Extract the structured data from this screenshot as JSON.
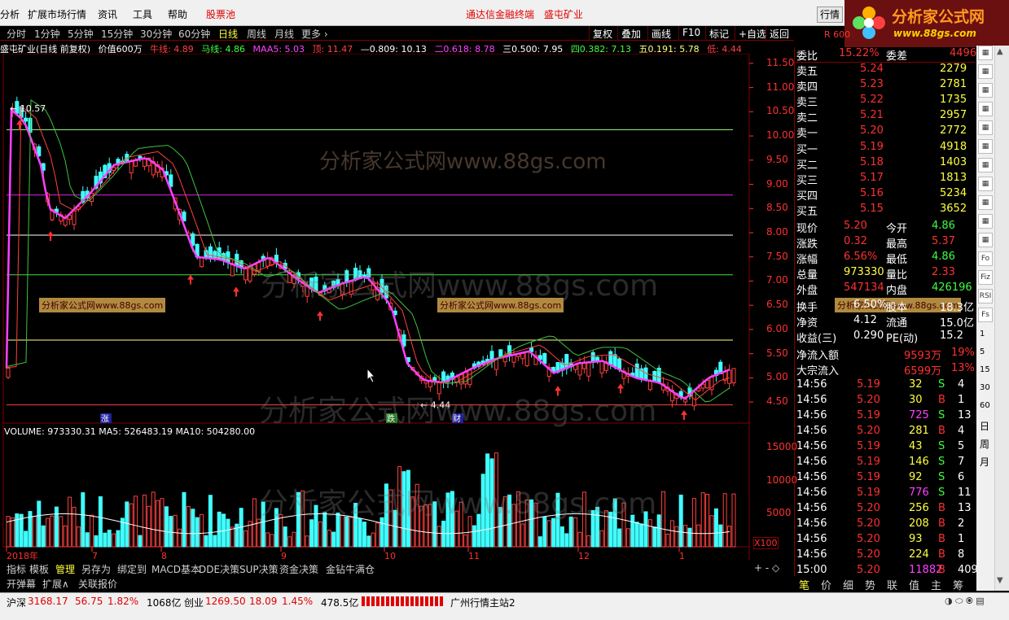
{
  "menu": {
    "items": [
      "分析",
      "扩展市场行情",
      "资讯",
      "工具",
      "帮助"
    ],
    "stock_pool": "股票池",
    "center_title": "通达信金融终端",
    "center_stock": "盛屯矿业",
    "market_button": "行情"
  },
  "logo": {
    "title": "分析家公式网",
    "url": "www.88gs.com"
  },
  "periods": [
    "分时",
    "1分钟",
    "5分钟",
    "15分钟",
    "30分钟",
    "60分钟",
    "日线",
    "周线",
    "月线",
    "更多 ›"
  ],
  "active_period": "日线",
  "toolbar": [
    "复权",
    "叠加",
    "画线",
    "F10",
    "标记",
    "+自选",
    "返回"
  ],
  "info": {
    "name": "盛屯矿业(日线 前复权)",
    "value": "价值600万",
    "niu": "牛线: 4.89",
    "ma_line": "马线: 4.86",
    "maa5": "MAA5: 5.03",
    "top": "顶: 11.47",
    "fib0": "—0.809: 10.13",
    "fib1": "二0.618: 8.78",
    "fib2": "三0.500: 7.95",
    "fib3": "四0.382: 7.13",
    "fib4": "五0.191: 5.78",
    "low": "低: 4.44"
  },
  "chart_data": {
    "type": "candlestick",
    "price_axis": {
      "ticks": [
        "11.50",
        "11.00",
        "10.50",
        "10.00",
        "9.50",
        "9.00",
        "8.50",
        "8.00",
        "7.50",
        "7.00",
        "6.50",
        "6.00",
        "5.50",
        "5.00",
        "4.50"
      ],
      "range": [
        4.3,
        11.7
      ]
    },
    "volume_axis": {
      "ticks": [
        "15000",
        "10000",
        "5000"
      ],
      "unit": "X100"
    },
    "x_ticks": [
      "2018年",
      "7",
      "8",
      "9",
      "10",
      "11",
      "12",
      "1"
    ],
    "labels": {
      "high": "10.57",
      "low": "4.44"
    },
    "volume_line": "VOLUME: 973330.31  MA5: 526483.19  MA10: 504280.00",
    "badges": [
      "涨",
      "跌",
      "财"
    ],
    "horizontal_lines": [
      {
        "price": 10.13,
        "color": "#a0ff80"
      },
      {
        "price": 8.78,
        "color": "#e020e0"
      },
      {
        "price": 7.95,
        "color": "#ffffff"
      },
      {
        "price": 7.13,
        "color": "#40e040"
      },
      {
        "price": 5.78,
        "color": "#ffff80"
      },
      {
        "price": 4.44,
        "color": "#ff4040"
      }
    ]
  },
  "watermarks": [
    "分析家公式网www.88gs.com",
    "分析家公式网www.88gs.com",
    "分析家公式网www.88gs.com"
  ],
  "notes": [
    "分析家公式网www.88gs.com",
    "分析家公式网www.88gs.com",
    "分析家公式网www.88gs.com"
  ],
  "quote": {
    "header": {
      "weibi_label": "委比",
      "weibi": "15.22%",
      "weicha_label": "委差",
      "weicha": "4496"
    },
    "asks": [
      {
        "label": "卖五",
        "price": "5.24",
        "vol": "2279"
      },
      {
        "label": "卖四",
        "price": "5.23",
        "vol": "2781"
      },
      {
        "label": "卖三",
        "price": "5.22",
        "vol": "1735"
      },
      {
        "label": "卖二",
        "price": "5.21",
        "vol": "2957"
      },
      {
        "label": "卖一",
        "price": "5.20",
        "vol": "2772"
      }
    ],
    "bids": [
      {
        "label": "买一",
        "price": "5.19",
        "vol": "4918"
      },
      {
        "label": "买二",
        "price": "5.18",
        "vol": "1403"
      },
      {
        "label": "买三",
        "price": "5.17",
        "vol": "1813"
      },
      {
        "label": "买四",
        "price": "5.16",
        "vol": "5234"
      },
      {
        "label": "买五",
        "price": "5.15",
        "vol": "3652"
      }
    ],
    "stats": [
      [
        "现价",
        "5.20",
        "今开",
        "4.86"
      ],
      [
        "涨跌",
        "0.32",
        "最高",
        "5.37"
      ],
      [
        "涨幅",
        "6.56%",
        "最低",
        "4.86"
      ],
      [
        "总量",
        "973330",
        "量比",
        "2.33"
      ],
      [
        "外盘",
        "547134",
        "内盘",
        "426196"
      ]
    ],
    "stats2": [
      [
        "换手",
        "6.50%",
        "股本",
        "18.3亿"
      ],
      [
        "净资",
        "4.12",
        "流通",
        "15.0亿"
      ],
      [
        "收益(三)",
        "0.290",
        "PE(动)",
        "15.2"
      ]
    ],
    "flows": [
      [
        "净流入额",
        "9593万",
        "19%"
      ],
      [
        "大宗流入",
        "6599万",
        "13%"
      ]
    ],
    "trades": [
      [
        "14:56",
        "5.19",
        "32",
        "S",
        "4"
      ],
      [
        "14:56",
        "5.20",
        "30",
        "B",
        "1"
      ],
      [
        "14:56",
        "5.19",
        "725",
        "S",
        "13"
      ],
      [
        "14:56",
        "5.20",
        "281",
        "B",
        "4"
      ],
      [
        "14:56",
        "5.19",
        "43",
        "S",
        "5"
      ],
      [
        "14:56",
        "5.19",
        "146",
        "S",
        "7"
      ],
      [
        "14:56",
        "5.19",
        "92",
        "S",
        "6"
      ],
      [
        "14:56",
        "5.19",
        "776",
        "S",
        "11"
      ],
      [
        "14:56",
        "5.20",
        "256",
        "B",
        "13"
      ],
      [
        "14:56",
        "5.20",
        "208",
        "B",
        "2"
      ],
      [
        "14:56",
        "5.20",
        "93",
        "B",
        "1"
      ],
      [
        "14:56",
        "5.20",
        "224",
        "B",
        "8"
      ],
      [
        "15:00",
        "5.20",
        "11882",
        "B",
        "409"
      ]
    ],
    "code_label": "R 600"
  },
  "bottom_tabs": [
    "指标",
    "模板",
    "管理",
    "另存为",
    "绑定到",
    "MACD基本",
    "DDE决策",
    "SUP决策",
    "资金决策",
    "金钻牛满仓"
  ],
  "bottom_tabs2": [
    "开弹幕",
    "扩展∧",
    "关联报价"
  ],
  "right_tabs": [
    "笔",
    "价",
    "细",
    "势",
    "联",
    "值",
    "主",
    "筹"
  ],
  "side_labels": [
    "日",
    "周",
    "月"
  ],
  "side_icons_text": [
    "Fo",
    "Fiz",
    "RSI",
    "Fs"
  ],
  "side_minutes": [
    "1",
    "5",
    "15",
    "30",
    "60"
  ],
  "status": {
    "sh_label": "沪深",
    "sh_index": "3168.17",
    "sh_chg": "56.75",
    "sh_pct": "1.82%",
    "sh_amt": "1068亿",
    "cy_label": "创业",
    "cy_index": "1269.50",
    "cy_chg": "18.09",
    "cy_pct": "1.45%",
    "cy_amt": "478.5亿",
    "server": "广州行情主站2"
  }
}
